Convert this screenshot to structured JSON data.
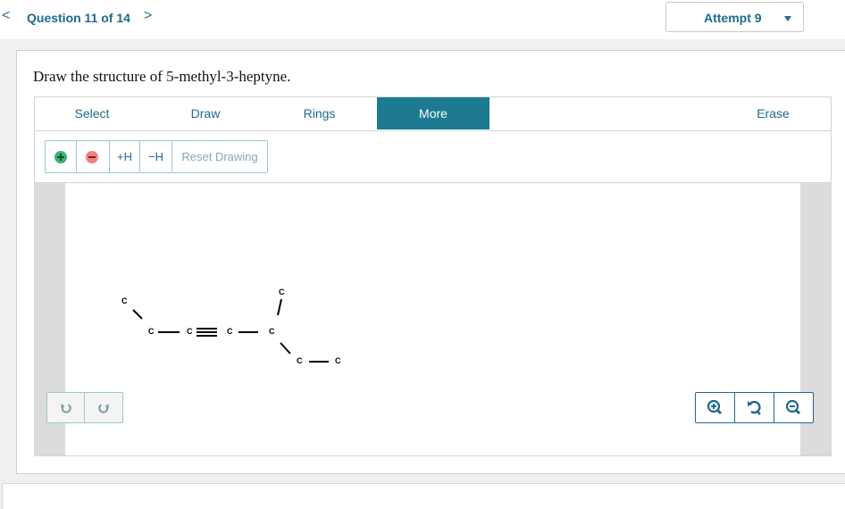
{
  "header": {
    "question_counter": "Question 11 of 14",
    "prev_glyph": "<",
    "next_glyph": ">",
    "attempt_label": "Attempt 9"
  },
  "question": {
    "prompt": "Draw the structure of 5-methyl-3-heptyne."
  },
  "tabs": [
    {
      "label": "Select",
      "active": false
    },
    {
      "label": "Draw",
      "active": false
    },
    {
      "label": "Rings",
      "active": false
    },
    {
      "label": "More",
      "active": true
    },
    {
      "label": "Erase",
      "active": false
    }
  ],
  "toolbar": {
    "add_h": "+H",
    "remove_h": "−H",
    "reset": "Reset Drawing"
  },
  "molecule": {
    "atoms": [
      "C",
      "C",
      "C",
      "C",
      "C",
      "C",
      "C",
      "C"
    ]
  },
  "colors": {
    "accent": "#1d7a91",
    "link": "#1f6a8a",
    "add_charge": "#3cb371",
    "remove_charge": "#f08080",
    "panel_gray": "#dcdcdc"
  },
  "icons": {
    "undo": "undo-icon",
    "redo": "redo-icon",
    "zoom_in": "zoom-in-icon",
    "reset_zoom": "reset-zoom-icon",
    "zoom_out": "zoom-out-icon"
  }
}
